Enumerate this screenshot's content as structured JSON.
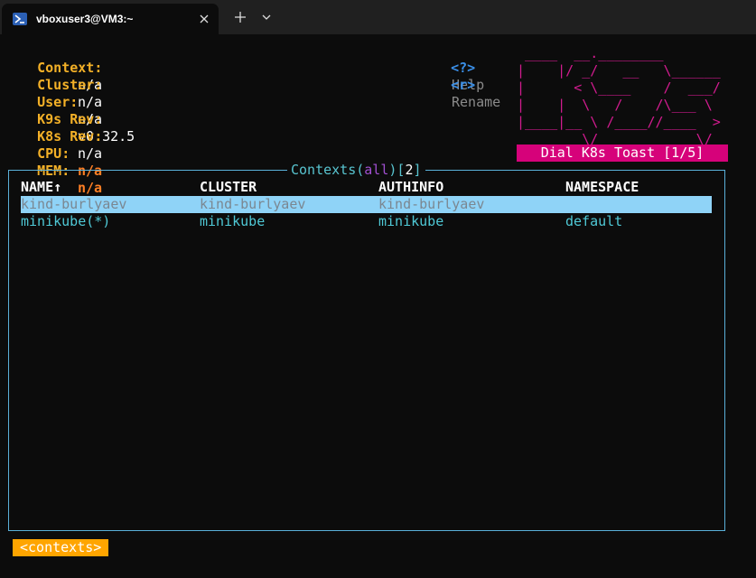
{
  "window": {
    "tab_title": "vboxuser3@VM3:~"
  },
  "header": {
    "info": [
      {
        "label": "Context:",
        "value": "n/a"
      },
      {
        "label": "Cluster:",
        "value": "n/a"
      },
      {
        "label": "User:",
        "value": "n/a"
      },
      {
        "label": "K9s Rev:",
        "value": "v0.32.5"
      },
      {
        "label": "K8s Rev:",
        "value": "n/a"
      },
      {
        "label": "CPU:",
        "value": "n/a"
      },
      {
        "label": "MEM:",
        "value": "n/a"
      }
    ],
    "shortcuts": [
      {
        "key": "<?>",
        "desc": "Help"
      },
      {
        "key": "<r>",
        "desc": "Rename"
      }
    ],
    "logo_ascii": " ____  __.________\n|    |/ _/   __   \\______\n|      < \\____    /  ___/\n|    |  \\   /    /\\___ \\\n|____|__ \\ /____//____  >\n        \\/            \\/",
    "toast": "Dial K8s Toast [1/5]"
  },
  "table": {
    "title_prefix": "Contexts(",
    "title_filter": "all",
    "title_mid": ")[",
    "title_count": "2",
    "title_suffix": "]",
    "columns": [
      "NAME↑",
      "CLUSTER",
      "AUTHINFO",
      "NAMESPACE"
    ],
    "rows": [
      {
        "name": "kind-burlyaev",
        "cluster": "kind-burlyaev",
        "authinfo": "kind-burlyaev",
        "namespace": ""
      },
      {
        "name": "minikube(*)",
        "cluster": "minikube",
        "authinfo": "minikube",
        "namespace": "default"
      }
    ]
  },
  "breadcrumb": "<contexts>",
  "colors": {
    "label": "#f3b027",
    "warn": "#ff7f24",
    "key": "#3a8fe8",
    "logo": "#d21b8f",
    "toast_bg": "#d6027a",
    "frame": "#5ab0d8",
    "selected_row": "#8fd3f7",
    "row_text": "#4fc9d6",
    "crumb_bg": "#ffa500"
  },
  "icons": [
    "powershell-icon",
    "close-icon",
    "plus-icon",
    "chevron-down-icon"
  ]
}
